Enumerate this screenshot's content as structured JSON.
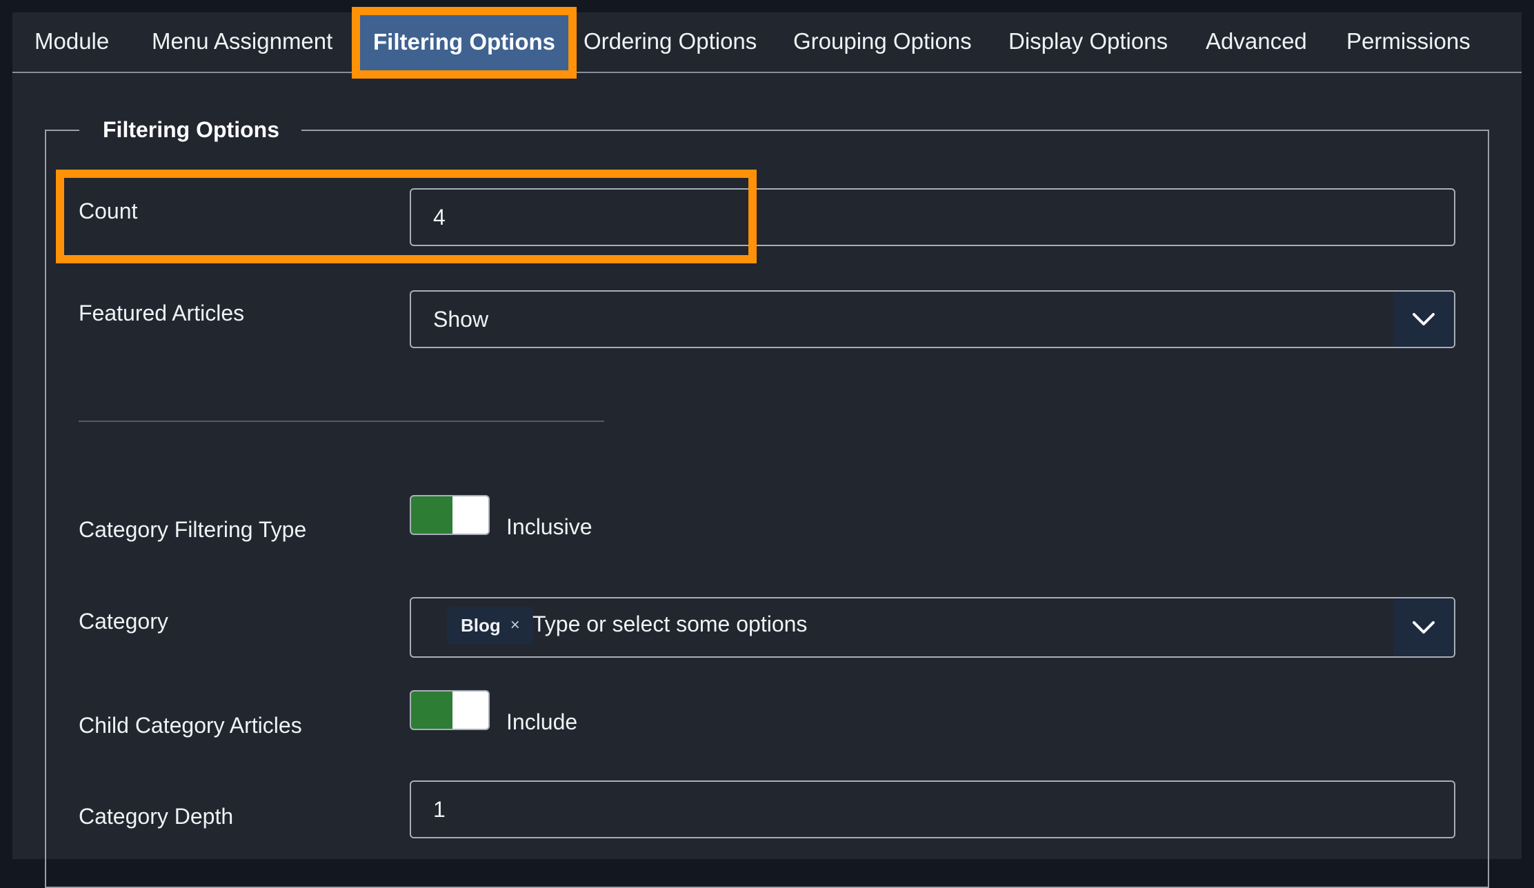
{
  "tabs": [
    {
      "label": "Module"
    },
    {
      "label": "Menu Assignment"
    },
    {
      "label": "Filtering Options"
    },
    {
      "label": "Ordering Options"
    },
    {
      "label": "Grouping Options"
    },
    {
      "label": "Display Options"
    },
    {
      "label": "Advanced"
    },
    {
      "label": "Permissions"
    }
  ],
  "active_tab": "Filtering Options",
  "fieldset": {
    "legend": "Filtering Options"
  },
  "fields": {
    "count": {
      "label": "Count",
      "value": "4"
    },
    "featured": {
      "label": "Featured Articles",
      "value": "Show"
    },
    "category_filtering_type": {
      "label": "Category Filtering Type",
      "state": "Inclusive"
    },
    "category": {
      "label": "Category",
      "selected": [
        "Blog"
      ],
      "remove_glyph": "×",
      "placeholder": "Type or select some options"
    },
    "child_category": {
      "label": "Child Category Articles",
      "state": "Include"
    },
    "category_depth": {
      "label": "Category Depth",
      "value": "1"
    }
  },
  "colors": {
    "page_bg": "#13171f",
    "panel_bg": "#22262e",
    "active_tab_bg": "#3f6291",
    "highlight": "#ff9208",
    "toggle_on": "#2e7d35",
    "chevron_box": "#1e2a3e"
  },
  "icons": {
    "dropdown": "chevron-down-icon",
    "remove": "close-icon"
  }
}
